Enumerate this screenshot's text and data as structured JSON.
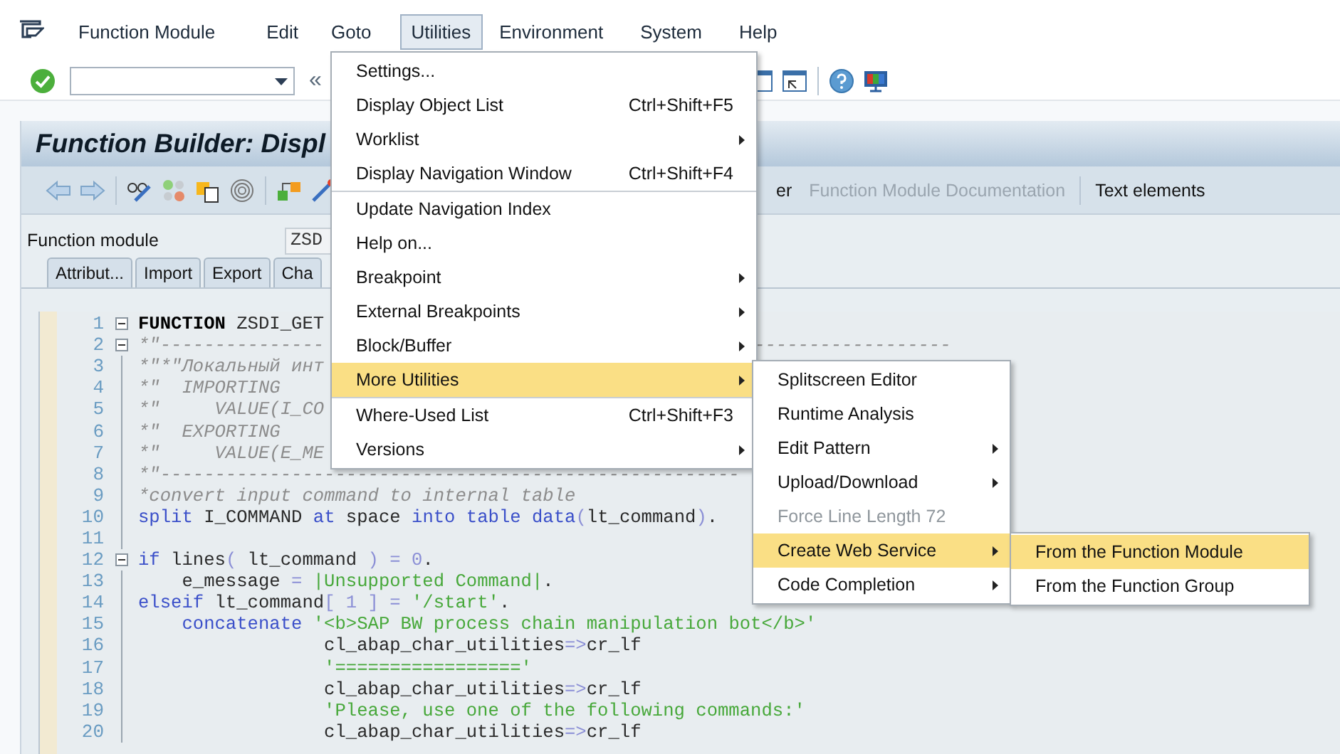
{
  "menubar": {
    "items": [
      {
        "label": "Function Module",
        "selected": false
      },
      {
        "label": "Edit",
        "selected": false
      },
      {
        "label": "Goto",
        "selected": false
      },
      {
        "label": "Utilities",
        "selected": true
      },
      {
        "label": "Environment",
        "selected": false
      },
      {
        "label": "System",
        "selected": false
      },
      {
        "label": "Help",
        "selected": false
      }
    ]
  },
  "toolbar": {
    "scroll_glyph": "«"
  },
  "title": "Function Builder: Displ",
  "app_toolbar": {
    "buttons": [
      {
        "label": "er",
        "disabled": false
      },
      {
        "label": "Function Module Documentation",
        "disabled": true
      },
      {
        "label": "Text elements",
        "disabled": false
      }
    ]
  },
  "function_module": {
    "label": "Function module",
    "value": "ZSD"
  },
  "tabs": [
    {
      "label": "Attribut...",
      "selected": false
    },
    {
      "label": "Import",
      "selected": false
    },
    {
      "label": "Export",
      "selected": false
    },
    {
      "label": "Cha",
      "selected": false
    }
  ],
  "editor": {
    "lines": [
      {
        "number": "1",
        "collapsible": true,
        "segments": [
          {
            "kind": "bold",
            "text": "FUNCTION"
          },
          {
            "kind": "plain",
            "text": " ZSDI_GET"
          }
        ]
      },
      {
        "number": "2",
        "collapsible": true,
        "segments": [
          {
            "kind": "comment",
            "text": "*\"---------------"
          }
        ],
        "tail": "------------------"
      },
      {
        "number": "3",
        "collapsible": false,
        "segments": [
          {
            "kind": "comment",
            "text": "*\"*\"Локальный инт"
          }
        ]
      },
      {
        "number": "4",
        "collapsible": false,
        "segments": [
          {
            "kind": "comment",
            "text": "*\"  IMPORTING"
          }
        ]
      },
      {
        "number": "5",
        "collapsible": false,
        "segments": [
          {
            "kind": "comment",
            "text": "*\"     VALUE(I_CO"
          }
        ]
      },
      {
        "number": "6",
        "collapsible": false,
        "segments": [
          {
            "kind": "comment",
            "text": "*\"  EXPORTING"
          }
        ]
      },
      {
        "number": "7",
        "collapsible": false,
        "segments": [
          {
            "kind": "comment",
            "text": "*\"     VALUE(E_ME"
          }
        ]
      },
      {
        "number": "8",
        "collapsible": false,
        "segments": [
          {
            "kind": "comment",
            "text": "*\"-----------------------------------------------------"
          }
        ]
      },
      {
        "number": "9",
        "collapsible": false,
        "segments": [
          {
            "kind": "comment",
            "text": "*convert input command to internal table"
          }
        ]
      },
      {
        "number": "10",
        "collapsible": false,
        "segments": [
          {
            "kind": "keyword",
            "text": "split"
          },
          {
            "kind": "plain",
            "text": " I_COMMAND "
          },
          {
            "kind": "keyword",
            "text": "at"
          },
          {
            "kind": "plain",
            "text": " space "
          },
          {
            "kind": "keyword",
            "text": "into table data"
          },
          {
            "kind": "operator",
            "text": "("
          },
          {
            "kind": "plain",
            "text": "lt_command"
          },
          {
            "kind": "operator",
            "text": ")"
          },
          {
            "kind": "plain",
            "text": "."
          }
        ]
      },
      {
        "number": "11",
        "collapsible": false
      },
      {
        "number": "12",
        "collapsible": true,
        "segments": [
          {
            "kind": "keyword",
            "text": "if"
          },
          {
            "kind": "plain",
            "text": " lines"
          },
          {
            "kind": "operator",
            "text": "("
          },
          {
            "kind": "plain",
            "text": " lt_command "
          },
          {
            "kind": "operator",
            "text": ") = 0"
          },
          {
            "kind": "plain",
            "text": "."
          }
        ]
      },
      {
        "number": "13",
        "collapsible": false,
        "segments": [
          {
            "kind": "plain",
            "text": "    e_message "
          },
          {
            "kind": "operator",
            "text": "= "
          },
          {
            "kind": "string",
            "text": "|Unsupported Command|"
          },
          {
            "kind": "plain",
            "text": "."
          }
        ]
      },
      {
        "number": "14",
        "collapsible": false,
        "segments": [
          {
            "kind": "keyword",
            "text": "elseif"
          },
          {
            "kind": "plain",
            "text": " lt_command"
          },
          {
            "kind": "operator",
            "text": "[ 1 ] = "
          },
          {
            "kind": "string",
            "text": "'/start'"
          },
          {
            "kind": "plain",
            "text": "."
          }
        ]
      },
      {
        "number": "15",
        "collapsible": false,
        "segments": [
          {
            "kind": "keyword",
            "text": "    concatenate "
          },
          {
            "kind": "string",
            "text": "'<b>SAP BW process chain manipulation bot</b>'"
          }
        ]
      },
      {
        "number": "16",
        "collapsible": false,
        "segments": [
          {
            "kind": "plain",
            "text": "                 cl_abap_char_utilities"
          },
          {
            "kind": "operator",
            "text": "=>"
          },
          {
            "kind": "plain",
            "text": "cr_lf"
          }
        ]
      },
      {
        "number": "17",
        "collapsible": false,
        "segments": [
          {
            "kind": "string",
            "text": "                 '================='"
          }
        ]
      },
      {
        "number": "18",
        "collapsible": false,
        "segments": [
          {
            "kind": "plain",
            "text": "                 cl_abap_char_utilities"
          },
          {
            "kind": "operator",
            "text": "=>"
          },
          {
            "kind": "plain",
            "text": "cr_lf"
          }
        ]
      },
      {
        "number": "19",
        "collapsible": false,
        "segments": [
          {
            "kind": "string",
            "text": "                 'Please, use one of the following commands:'"
          }
        ]
      },
      {
        "number": "20",
        "collapsible": false,
        "segments": [
          {
            "kind": "plain",
            "text": "                 cl_abap_char_utilities"
          },
          {
            "kind": "operator",
            "text": "=>"
          },
          {
            "kind": "plain",
            "text": "cr_lf"
          }
        ]
      }
    ]
  },
  "utilities_menu": {
    "items": [
      {
        "label": "Settings...",
        "has_submenu": false,
        "highlighted": false
      },
      {
        "label": "Display Object List",
        "shortcut": "Ctrl+Shift+F5",
        "has_submenu": false,
        "highlighted": false
      },
      {
        "label": "Worklist",
        "has_submenu": true,
        "highlighted": false
      },
      {
        "label": "Display Navigation Window",
        "shortcut": "Ctrl+Shift+F4",
        "has_submenu": false,
        "highlighted": false
      },
      {
        "label": "Update Navigation Index",
        "separator_before": true,
        "has_submenu": false,
        "highlighted": false
      },
      {
        "label": "Help on...",
        "has_submenu": false,
        "highlighted": false
      },
      {
        "label": "Breakpoint",
        "has_submenu": true,
        "highlighted": false
      },
      {
        "label": "External Breakpoints",
        "has_submenu": true,
        "highlighted": false
      },
      {
        "label": "Block/Buffer",
        "has_submenu": true,
        "highlighted": false
      },
      {
        "label": "More Utilities",
        "has_submenu": true,
        "highlighted": true
      },
      {
        "label": "Where-Used List",
        "shortcut": "Ctrl+Shift+F3",
        "separator_before": true,
        "has_submenu": false,
        "highlighted": false
      },
      {
        "label": "Versions",
        "has_submenu": true,
        "highlighted": false
      }
    ]
  },
  "more_utilities_menu": {
    "items": [
      {
        "label": "Splitscreen Editor",
        "has_submenu": false,
        "highlighted": false,
        "disabled": false
      },
      {
        "label": "Runtime Analysis",
        "has_submenu": false,
        "highlighted": false,
        "disabled": false
      },
      {
        "label": "Edit Pattern",
        "has_submenu": true,
        "highlighted": false,
        "disabled": false
      },
      {
        "label": "Upload/Download",
        "has_submenu": true,
        "highlighted": false,
        "disabled": false
      },
      {
        "label": "Force Line Length 72",
        "has_submenu": false,
        "highlighted": false,
        "disabled": true
      },
      {
        "label": "Create Web Service",
        "has_submenu": true,
        "highlighted": true,
        "disabled": false
      },
      {
        "label": "Code Completion",
        "has_submenu": true,
        "highlighted": false,
        "disabled": false
      }
    ]
  },
  "web_service_menu": {
    "items": [
      {
        "label": "From the Function Module",
        "highlighted": true
      },
      {
        "label": "From the Function Group",
        "highlighted": false
      }
    ]
  }
}
